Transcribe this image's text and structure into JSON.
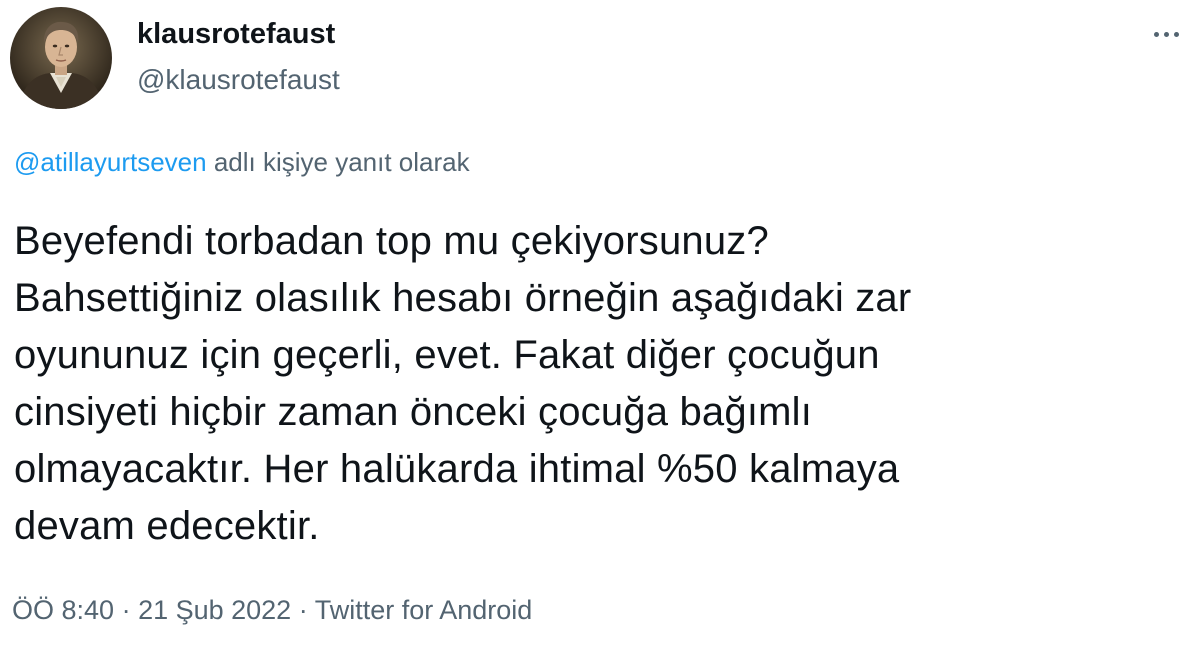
{
  "author": {
    "display_name": "klausrotefaust",
    "handle": "@klausrotefaust",
    "avatar": "portrait-avatar"
  },
  "more_icon": "ellipsis-icon",
  "reply_context": {
    "mention": "@atillayurtseven",
    "suffix": " adlı kişiye yanıt olarak"
  },
  "tweet": {
    "lines": [
      "Beyefendi torbadan top mu çekiyorsunuz?",
      "Bahsettiğiniz olasılık hesabı örneğin aşağıdaki zar",
      "oyununuz için geçerli, evet. Fakat diğer çocuğun",
      "cinsiyeti hiçbir zaman önceki çocuğa bağımlı",
      "olmayacaktır. Her halükarda ihtimal %50 kalmaya",
      "devam edecektir."
    ]
  },
  "meta": {
    "time": "ÖÖ 8:40",
    "separator": " · ",
    "date": "21 Şub 2022",
    "source": "Twitter for Android"
  },
  "colors": {
    "text": "#0f1419",
    "secondary": "#536471",
    "link": "#1d9bf0"
  }
}
